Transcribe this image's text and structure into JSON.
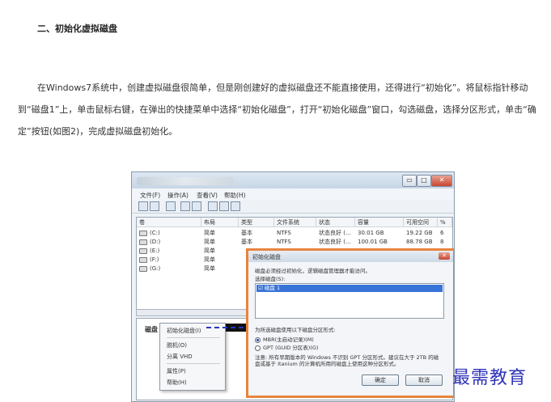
{
  "heading": "二、初始化虚拟磁盘",
  "paragraph": "在Windows7系统中，创建虚拟磁盘很简单，但是刚创建好的虚拟磁盘还不能直接使用，还得进行“初始化”。将鼠标指针移动到“磁盘1”上，单击鼠标右键，在弹出的快捷菜单中选择“初始化磁盘”，打开“初始化磁盘”窗口，勾选磁盘，选择分区形式，单击“确定”按钮(如图2)，完成虚拟磁盘初始化。",
  "figure": {
    "window_buttons": [
      "▭",
      "□",
      "✕"
    ],
    "menu": [
      "文件(F)",
      "操作(A)",
      "查看(V)",
      "帮助(H)"
    ],
    "columns": [
      "卷",
      "布局",
      "类型",
      "文件系统",
      "状态",
      "容量",
      "可用空间",
      "%"
    ],
    "rows": [
      {
        "vol": "(C:)",
        "layout": "简单",
        "type": "基本",
        "fs": "NTFS",
        "status": "状态良好 (...",
        "cap": "30.01 GB",
        "free": "19.22 GB",
        "pct": "6"
      },
      {
        "vol": "(D:)",
        "layout": "简单",
        "type": "基本",
        "fs": "NTFS",
        "status": "状态良好 (...",
        "cap": "100.01 GB",
        "free": "88.78 GB",
        "pct": "8"
      },
      {
        "vol": "(E:)",
        "layout": "简单",
        "type": "",
        "fs": "",
        "status": "",
        "cap": "",
        "free": "",
        "pct": ""
      },
      {
        "vol": "(F:)",
        "layout": "简单",
        "type": "",
        "fs": "",
        "status": "",
        "cap": "",
        "free": "",
        "pct": ""
      },
      {
        "vol": "(G:)",
        "layout": "简单",
        "type": "",
        "fs": "",
        "status": "",
        "cap": "",
        "free": "",
        "pct": ""
      }
    ],
    "disk_label": "磁盘 1",
    "context_menu": [
      "初始化磁盘(I)",
      "脱机(O)",
      "分离 VHD",
      "属性(P)",
      "帮助(H)"
    ],
    "dialog": {
      "title": "初始化磁盘",
      "close": "✕",
      "line1": "磁盘必须经过初始化，逻辑磁盘管理器才能访问。",
      "line2": "选择磁盘(S):",
      "disk_item": "☑ 磁盘 1",
      "partition_label": "为所选磁盘使用以下磁盘分区形式:",
      "option_mbr": "MBR(主启动记录)(M)",
      "option_gpt": "GPT (GUID 分区表)(G)",
      "note": "注意: 所有早期版本的 Windows 不识别 GPT 分区形式。建议在大于 2TB 的磁盘或基于 Itanium 的计算机所用的磁盘上使用这种分区形式。",
      "ok": "确定",
      "cancel": "取消"
    }
  },
  "watermark": "最需教育"
}
